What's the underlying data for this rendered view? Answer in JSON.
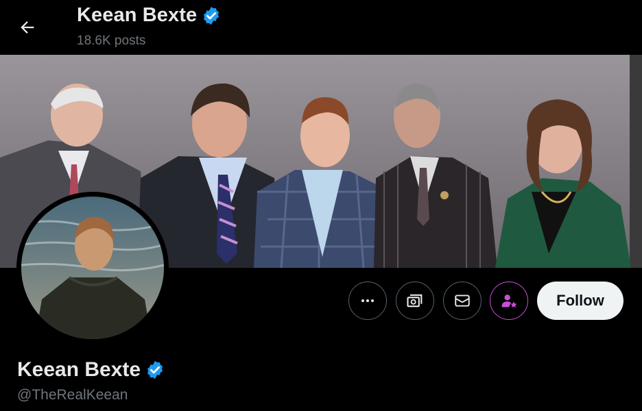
{
  "header": {
    "display_name": "Keean Bexte",
    "post_count": "18.6K posts"
  },
  "profile": {
    "display_name": "Keean Bexte",
    "handle": "@TheRealKeean",
    "verified": true
  },
  "actions": {
    "more_icon": "more-horizontal-icon",
    "subscribe_icon": "subscriptions-icon",
    "message_icon": "envelope-icon",
    "notify_icon": "person-star-icon",
    "follow_label": "Follow"
  },
  "colors": {
    "background": "#000000",
    "verified_blue": "#1d9bf0",
    "secondary_text": "#71767b",
    "purple_accent": "#c94fd6",
    "follow_bg": "#eff3f4"
  }
}
